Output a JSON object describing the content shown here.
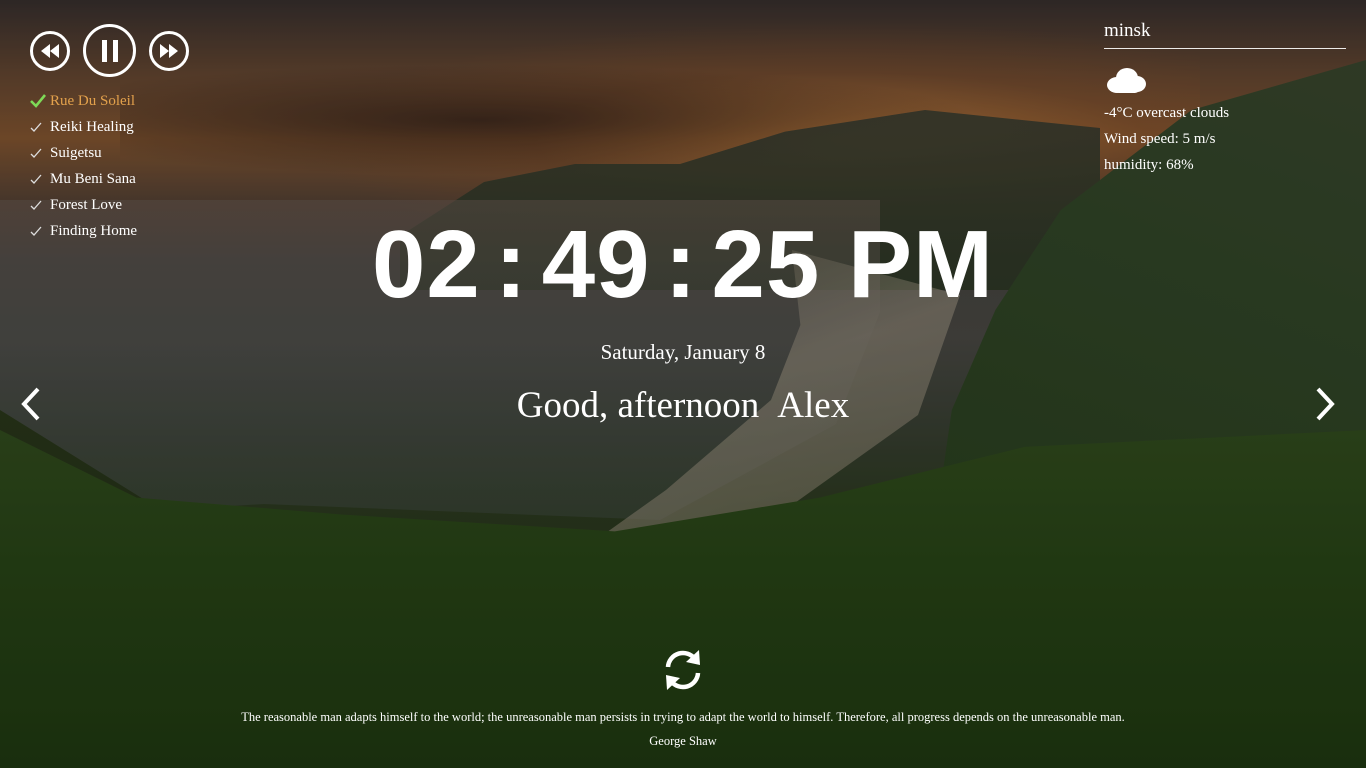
{
  "player": {
    "rewind_icon": "rewind-icon",
    "pause_icon": "pause-icon",
    "forward_icon": "fast-forward-icon"
  },
  "playlist": [
    {
      "title": "Rue Du Soleil",
      "active": true
    },
    {
      "title": "Reiki Healing",
      "active": false
    },
    {
      "title": "Suigetsu",
      "active": false
    },
    {
      "title": "Mu Beni Sana",
      "active": false
    },
    {
      "title": "Forest Love",
      "active": false
    },
    {
      "title": "Finding Home",
      "active": false
    }
  ],
  "weather": {
    "city": "minsk",
    "icon": "cloud-icon",
    "description": "-4°C overcast clouds",
    "wind": "Wind speed: 5 m/s",
    "humidity": "humidity: 68%"
  },
  "clock": {
    "hours": "02",
    "minutes": "49",
    "seconds": "25",
    "separator": ":",
    "period": "PM"
  },
  "date": "Saturday, January 8",
  "greeting": {
    "text": "Good, afternoon",
    "name": "Alex"
  },
  "quote": {
    "text": "The reasonable man adapts himself to the world; the unreasonable man persists in trying to adapt the world to himself. Therefore, all progress depends on the unreasonable man.",
    "author": "George Shaw"
  },
  "colors": {
    "active_track": "#e3a14c",
    "active_check": "#7ed957",
    "text": "#ffffff"
  }
}
